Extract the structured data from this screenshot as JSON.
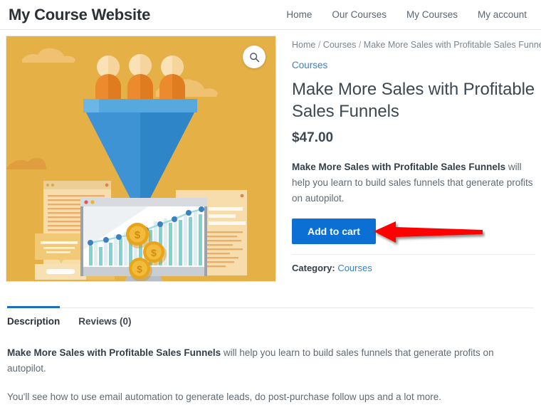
{
  "header": {
    "site_title": "My Course Website",
    "nav": [
      {
        "label": "Home"
      },
      {
        "label": "Our Courses"
      },
      {
        "label": "My Courses"
      },
      {
        "label": "My account"
      }
    ]
  },
  "gallery": {
    "zoom_icon": "search-icon",
    "image_alt": "Sales funnel illustration with people, funnel, coins and analytics monitor",
    "colors": {
      "background": "#e5b046",
      "cloud": "#f0c372",
      "funnel_body": "#2e86c8",
      "funnel_rim": "#6cb6e6",
      "person_body": "#e8832a",
      "person_head": "#fbe0b0",
      "coin": "#e8a51c",
      "chart_bar": "#7fd4d2"
    }
  },
  "breadcrumb": {
    "items": [
      "Home",
      "Courses",
      "Make More Sales with Profitable Sales Funnels"
    ],
    "separator": "/"
  },
  "product": {
    "category_link": "Courses",
    "title": "Make More Sales with Profitable Sales Funnels",
    "price": "$47.00",
    "short_description_bold": "Make More Sales with Profitable Sales Funnels",
    "short_description_rest": " will help you learn to build sales funnels that generate profits on autopilot.",
    "add_to_cart_label": "Add to cart",
    "category_label": "Category:",
    "category_value": "Courses",
    "accent_button_color": "#0c6fd4",
    "annotation_arrow_color": "#ff0000"
  },
  "tabs": {
    "items": [
      {
        "label": "Description",
        "active": true
      },
      {
        "label": "Reviews (0)",
        "active": false
      }
    ],
    "active_underline_color": "#1b6ec2",
    "panel": {
      "para1_bold": "Make More Sales with Profitable Sales Funnels",
      "para1_rest": " will help you learn to build sales funnels that generate profits on autopilot.",
      "para2": "You'll see how to use email automation to generate leads, do post-purchase follow ups and a lot more."
    }
  }
}
